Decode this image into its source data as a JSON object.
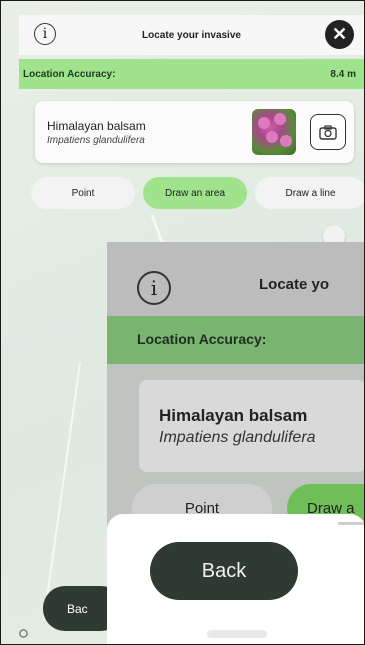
{
  "header": {
    "title": "Locate your invasive",
    "info_icon": "info-icon",
    "close_icon": "close-icon"
  },
  "accuracy": {
    "label": "Location Accuracy:",
    "value": "8.4 m"
  },
  "species": {
    "common_name": "Himalayan balsam",
    "latin_name": "Impatiens glandulifera",
    "camera_icon": "camera-icon"
  },
  "modes": [
    {
      "label": "Point",
      "active": false
    },
    {
      "label": "Draw an area",
      "active": true
    },
    {
      "label": "Draw a line",
      "active": false
    }
  ],
  "back_button": {
    "label": "Bac"
  },
  "overlay": {
    "title": "Locate yo",
    "accuracy_label": "Location Accuracy:",
    "common_name": "Himalayan balsam",
    "latin_name": "Impatiens glandulifera",
    "mode_point": "Point",
    "mode_area": "Draw a",
    "back_label": "Back"
  },
  "colors": {
    "accent": "#9fe38c",
    "dark": "#2f3a33"
  }
}
